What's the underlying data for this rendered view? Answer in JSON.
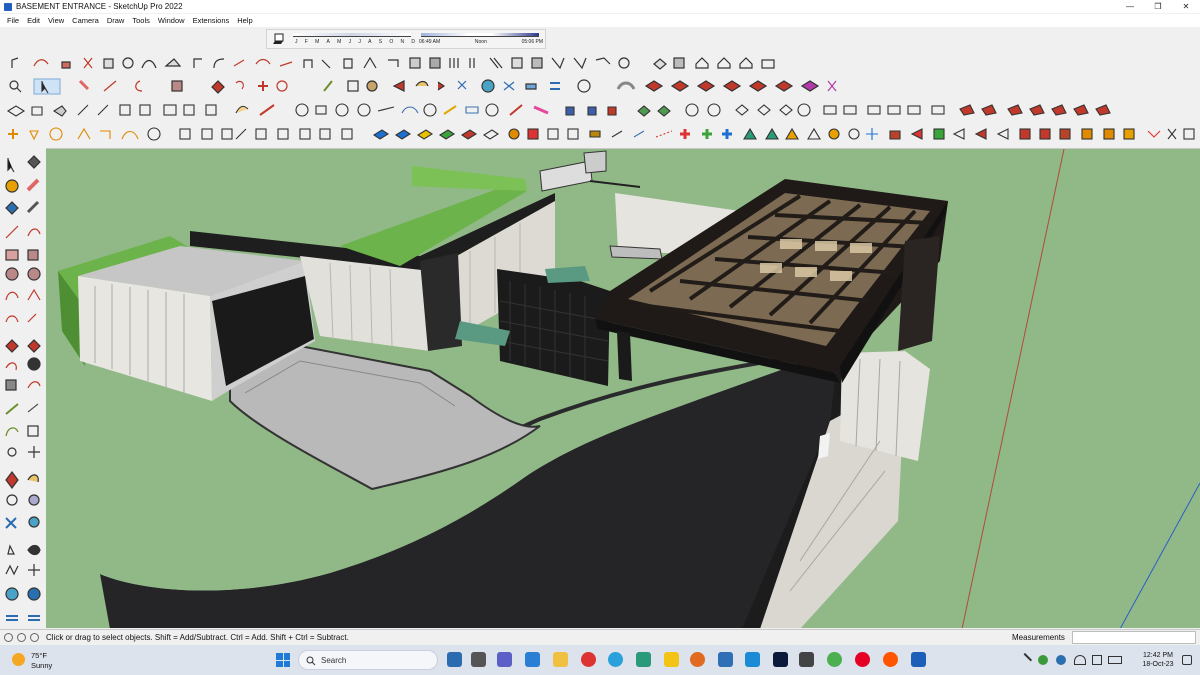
{
  "window": {
    "title": "BASEMENT ENTRANCE - SketchUp Pro 2022"
  },
  "menu": [
    "File",
    "Edit",
    "View",
    "Camera",
    "Draw",
    "Tools",
    "Window",
    "Extensions",
    "Help"
  ],
  "shadow": {
    "months": [
      "J",
      "F",
      "M",
      "A",
      "M",
      "J",
      "J",
      "A",
      "S",
      "O",
      "N",
      "D"
    ],
    "time_start": "06:49 AM",
    "time_mid": "Noon",
    "time_end": "05:06 PM"
  },
  "status": {
    "hint": "Click or drag to select objects. Shift = Add/Subtract. Ctrl = Add. Shift + Ctrl = Subtract.",
    "measurements_label": "Measurements",
    "measurements_value": ""
  },
  "taskbar": {
    "weather_temp": "75°F",
    "weather_desc": "Sunny",
    "search_placeholder": "Search",
    "time": "12:42 PM",
    "date": "18-Oct-23"
  },
  "colors": {
    "ground": "#91b987",
    "asphalt": "#252527",
    "paving": "#b9b9b9",
    "hedge": "#5ea63a",
    "pergola": "#2a2420",
    "wall": "#e8e6e0",
    "accent": "#1e7bd8"
  }
}
